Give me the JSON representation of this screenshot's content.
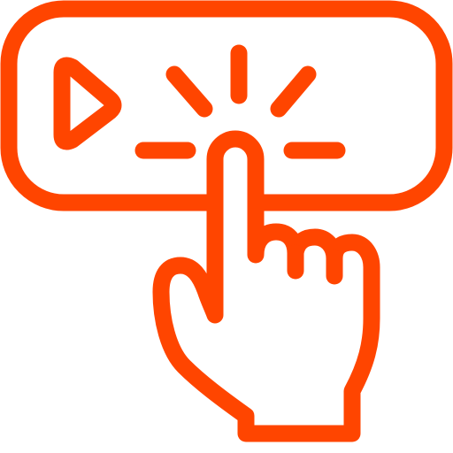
{
  "icon": {
    "name": "tap-to-play-icon",
    "color": "#ff4500",
    "background": "#ffffff",
    "parts": [
      "play-bar",
      "play-triangle",
      "click-rays",
      "pointing-hand"
    ]
  }
}
